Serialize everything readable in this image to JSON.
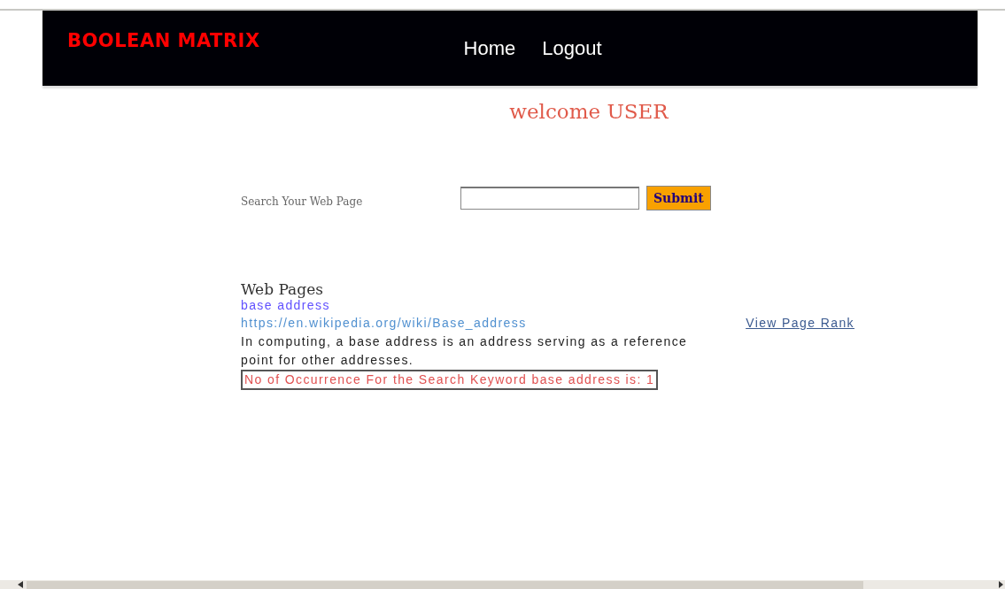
{
  "header": {
    "logo": "BOOLEAN MATRIX",
    "nav": [
      "Home",
      "Logout"
    ]
  },
  "welcome": "welcome USER",
  "search": {
    "label": "Search Your Web Page",
    "button": "Submit"
  },
  "results": {
    "heading": "Web Pages",
    "items": [
      {
        "title": "base address",
        "url": "https://en.wikipedia.org/wiki/Base_address",
        "rank_link": "View Page Rank",
        "description": "In computing, a base address is an address serving as a reference point for other addresses.",
        "occurrence": "No of Occurrence For the Search Keyword base address is: 1"
      }
    ]
  }
}
